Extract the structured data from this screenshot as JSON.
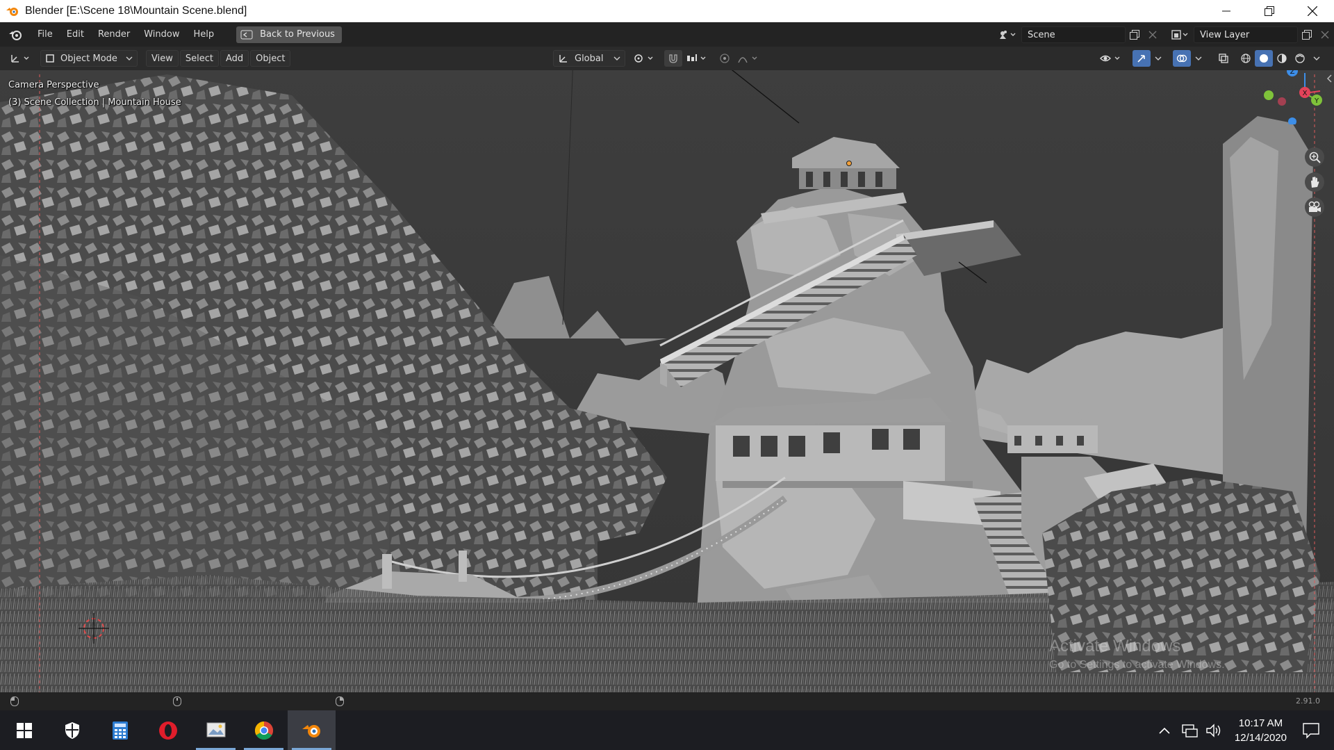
{
  "window": {
    "title": "Blender [E:\\Scene 18\\Mountain Scene.blend]"
  },
  "topbar": {
    "menus": [
      "File",
      "Edit",
      "Render",
      "Window",
      "Help"
    ],
    "back_label": "Back to Previous",
    "scene_name": "Scene",
    "view_layer": "View Layer"
  },
  "viewport_header": {
    "mode": "Object Mode",
    "menus": [
      "View",
      "Select",
      "Add",
      "Object"
    ],
    "orientation": "Global"
  },
  "viewport": {
    "camera_label": "Camera Perspective",
    "collection_label": "(3) Scene Collection | Mountain House",
    "watermark_line1": "Activate Windows",
    "watermark_line2": "Go to Settings to activate Windows."
  },
  "gizmo": {
    "x_label": "X",
    "y_label": "Y",
    "z_label": "Z",
    "colors": {
      "x": "#e4435a",
      "y": "#7fc23a",
      "z": "#3d8ee8"
    }
  },
  "statusbar": {
    "version": "2.91.0"
  },
  "taskbar": {
    "apps": [
      "windows-start",
      "windows-security",
      "calculator",
      "opera",
      "photos",
      "chrome",
      "blender"
    ],
    "time": "10:17 AM",
    "date": "12/14/2020"
  }
}
